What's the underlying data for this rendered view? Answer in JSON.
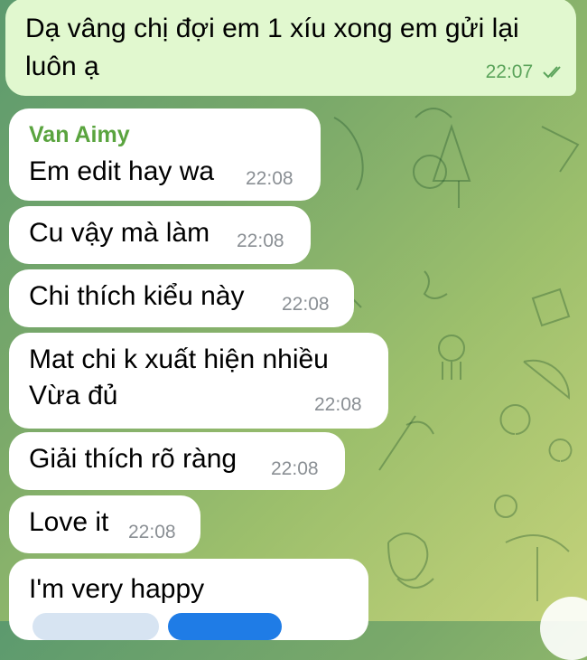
{
  "chat": {
    "outgoing": {
      "text_line1": "Dạ vâng chị đợi em 1 xíu xong em gửi lại",
      "text_line2": "luôn ạ",
      "time": "22:07"
    },
    "incoming": [
      {
        "sender": "Van Aimy",
        "text": "Em edit hay wa",
        "time": "22:08"
      },
      {
        "text": "Cu vậy mà làm",
        "time": "22:08"
      },
      {
        "text": "Chi thích kiểu này",
        "time": "22:08"
      },
      {
        "text_line1": "Mat chi k xuất hiện nhiều",
        "text_line2": "Vừa đủ",
        "time": "22:08"
      },
      {
        "text": "Giải thích rõ ràng",
        "time": "22:08"
      },
      {
        "text": "Love it",
        "time": "22:08"
      },
      {
        "text": "I'm very happy"
      }
    ]
  },
  "status": {
    "read": "double-check-icon"
  }
}
